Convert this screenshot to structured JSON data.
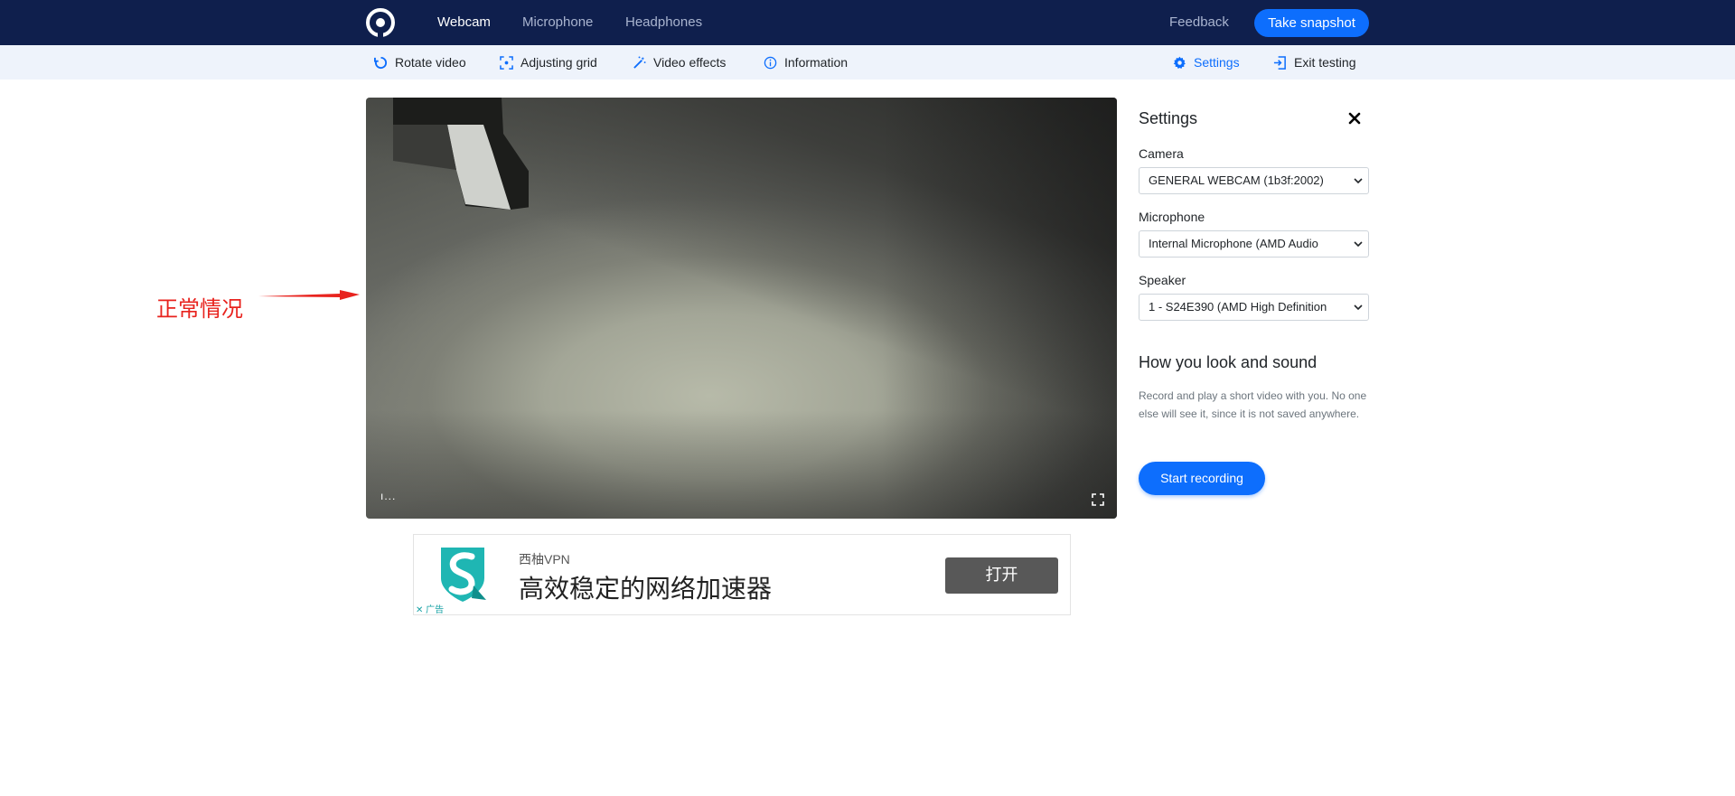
{
  "nav": {
    "items": [
      "Webcam",
      "Microphone",
      "Headphones"
    ],
    "feedback": "Feedback",
    "snapshot_label": "Take snapshot"
  },
  "toolbar": {
    "rotate": "Rotate video",
    "grid": "Adjusting grid",
    "effects": "Video effects",
    "info": "Information",
    "settings": "Settings",
    "exit": "Exit testing"
  },
  "annotation": {
    "text": "正常情况"
  },
  "video_controls": {
    "left_indicator": "ı..."
  },
  "ad": {
    "brand": "西柚VPN",
    "headline": "高效稳定的网络加速器",
    "button": "打开",
    "tag": "✕ 广告"
  },
  "settings": {
    "title": "Settings",
    "camera_label": "Camera",
    "camera_value": "GENERAL WEBCAM (1b3f:2002)",
    "microphone_label": "Microphone",
    "microphone_value": "Internal Microphone (AMD Audio",
    "speaker_label": "Speaker",
    "speaker_value": "1 - S24E390 (AMD High Definition",
    "preview_title": "How you look and sound",
    "preview_desc": "Record and play a short video with you. No one else will see it, since it is not saved anywhere.",
    "record_button": "Start recording"
  },
  "colors": {
    "topbar": "#0f1f4d",
    "accent": "#0d6efd",
    "toolbar_bg": "#eef3fb",
    "annotation": "#e8231e"
  }
}
